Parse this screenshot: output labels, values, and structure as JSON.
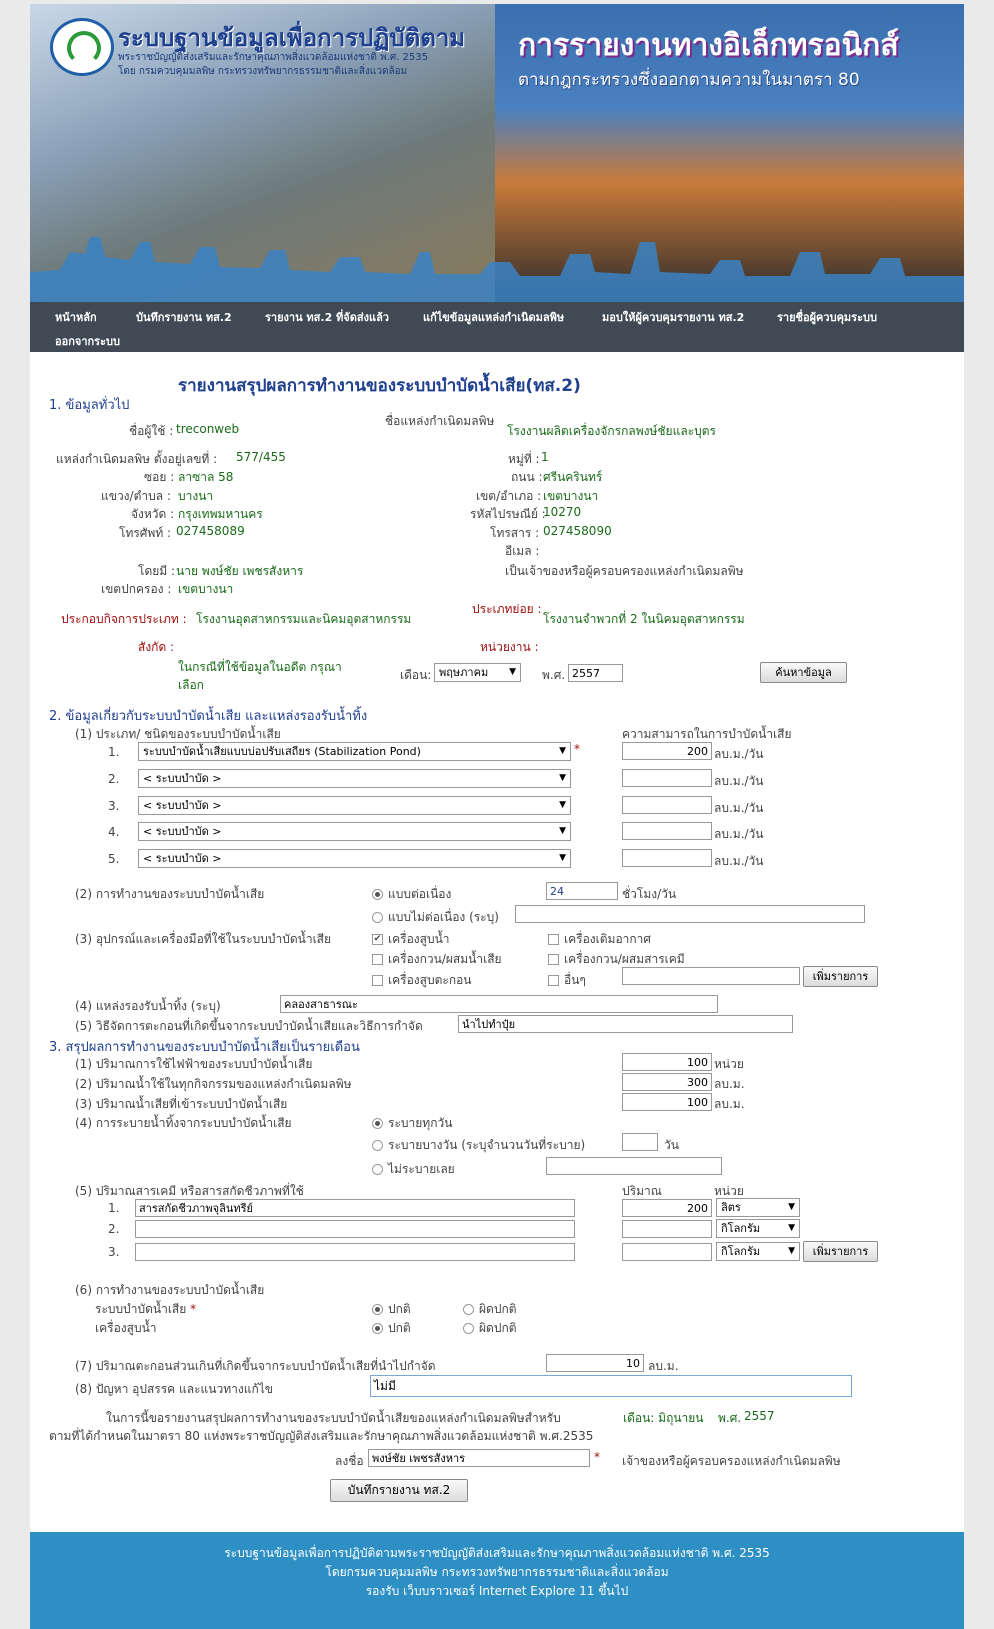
{
  "banner": {
    "left_title": "ระบบฐานข้อมูลเพื่อการปฏิบัติตาม",
    "left_sub1": "พระราชบัญญัติส่งเสริมและรักษาคุณภาพสิ่งแวดล้อมแห่งชาติ พ.ศ. 2535",
    "left_sub2": "โดย กรมควบคุมมลพิษ กระทรวงทรัพยากรธรรมชาติและสิ่งแวดล้อม",
    "right_title": "การรายงานทางอิเล็กทรอนิกส์",
    "right_sub": "ตามกฎกระทรวงซึ่งออกตามความในมาตรา 80"
  },
  "nav": {
    "home": "หน้าหลัก",
    "record": "บันทึกรายงาน ทส.2",
    "sent": "รายงาน ทส.2 ที่จัดส่งแล้ว",
    "edit_source": "แก้ไขข้อมูลแหล่งกำเนิดมลพิษ",
    "assign": "มอบให้ผู้ควบคุมรายงาน ทส.2",
    "controllers": "รายชื่อผู้ควบคุมระบบ",
    "logout": "ออกจากระบบ"
  },
  "form": {
    "title": "รายงานสรุปผลการทำงานของระบบบำบัดน้ำเสีย(ทส.2)",
    "s1": "1. ข้อมูลทั่วไป",
    "user_label": "ชื่อผู้ใช้ :",
    "user": "treconweb",
    "source_name_label": "ชื่อแหล่งกำเนิดมลพิษ",
    "source_name": "โรงงานผลิตเครื่องจักรกลพงษ์ชัยและบุตร",
    "address_label": "แหล่งกำเนิดมลพิษ ตั้งอยู่เลขที่ :",
    "address": "577/455",
    "moo_label": "หมู่ที่ :",
    "moo": "1",
    "soi_label": "ซอย :",
    "soi": "ลาซาล 58",
    "road_label": "ถนน :",
    "road": "ศรีนครินทร์",
    "subdistrict_label": "แขวง/ตำบล :",
    "subdistrict": "บางนา",
    "district_label": "เขต/อำเภอ :",
    "district": "เขตบางนา",
    "province_label": "จังหวัด :",
    "province": "กรุงเทพมหานคร",
    "postcode_label": "รหัสไปรษณีย์ :",
    "postcode": "10270",
    "phone_label": "โทรศัพท์ :",
    "phone": "027458089",
    "fax_label": "โทรสาร :",
    "fax": "027458090",
    "email_label": "อีเมล :",
    "by_label": "โดยมี :",
    "by": "นาย พงษ์ชัย เพชรสังหาร",
    "owner_role": "เป็นเจ้าของหรือผู้ครอบครองแหล่งกำเนิดมลพิษ",
    "admin_label": "เขตปกครอง :",
    "admin": "เขตบางนา",
    "biz_type_label": "ประกอบกิจการประเภท :",
    "biz_type": "โรงงานอุตสาหกรรมและนิคมอุตสาหกรรม",
    "sub_type_label": "ประเภทย่อย :",
    "sub_type": "โรงงานจำพวกที่ 2 ในนิคมอุตสาหกรรม",
    "affiliation_label": "สังกัด :",
    "unit_label": "หน่วยงาน :",
    "past_label_1": "ในกรณีที่ใช้ข้อมูลในอดีต กรุณา",
    "past_label_2": "เลือก",
    "month_label": "เดือน:",
    "month": "พฤษภาคม",
    "year_label": "พ.ศ.",
    "year": "2557",
    "search_btn": "ค้นหาข้อมูล",
    "s2": "2. ข้อมูลเกี่ยวกับระบบบำบัดน้ำเสีย และแหล่งรองรับน้ำทิ้ง",
    "q1": "(1) ประเภท/ ชนิดของระบบบำบัดน้ำเสีย",
    "capacity_label": "ความสามารถในการบำบัดน้ำเสีย",
    "systems": [
      {
        "no": "1.",
        "value": "ระบบบำบัดน้ำเสียแบบบ่อปรับเสถียร (Stabilization Pond)",
        "cap": "200",
        "unit": "ลบ.ม./วัน"
      },
      {
        "no": "2.",
        "value": "< ระบบบำบัด >",
        "cap": "",
        "unit": "ลบ.ม./วัน"
      },
      {
        "no": "3.",
        "value": "< ระบบบำบัด >",
        "cap": "",
        "unit": "ลบ.ม./วัน"
      },
      {
        "no": "4.",
        "value": "< ระบบบำบัด >",
        "cap": "",
        "unit": "ลบ.ม./วัน"
      },
      {
        "no": "5.",
        "value": "< ระบบบำบัด >",
        "cap": "",
        "unit": "ลบ.ม./วัน"
      }
    ],
    "q2": "(2) การทำงานของระบบบำบัดน้ำเสีย",
    "continuous": "แบบต่อเนื่อง",
    "hours": "24",
    "hours_unit": "ชั่วโมง/วัน",
    "non_continuous": "แบบไม่ต่อเนื่อง (ระบุ)",
    "q3": "(3) อุปกรณ์และเครื่องมือที่ใช้ในระบบบำบัดน้ำเสีย",
    "eq_pump": "เครื่องสูบน้ำ",
    "eq_aerator": "เครื่องเติมอากาศ",
    "eq_mixer": "เครื่องกวน/ผสมน้ำเสีย",
    "eq_chem_mixer": "เครื่องกวน/ผสมสารเคมี",
    "eq_sludge_pump": "เครื่องสูบตะกอน",
    "eq_other": "อื่นๆ",
    "add_btn": "เพิ่มรายการ",
    "q4": "(4) แหล่งรองรับน้ำทิ้ง (ระบุ)",
    "receiving": "คลองสาธารณะ",
    "q5": "(5) วิธีจัดการตะกอนที่เกิดขึ้นจากระบบบำบัดน้ำเสียและวิธีการกำจัด",
    "sludge_method": "นำไปทำปุ๋ย",
    "s3": "3. สรุปผลการทำงานของระบบบำบัดน้ำเสียเป็นรายเดือน",
    "m1": "(1) ปริมาณการใช้ไฟฟ้าของระบบบำบัดน้ำเสีย",
    "m1_val": "100",
    "m1_unit": "หน่วย",
    "m2": "(2) ปริมาณน้ำใช้ในทุกกิจกรรมของแหล่งกำเนิดมลพิษ",
    "m2_val": "300",
    "m2_unit": "ลบ.ม.",
    "m3": "(3) ปริมาณน้ำเสียที่เข้าระบบบำบัดน้ำเสีย",
    "m3_val": "100",
    "m3_unit": "ลบ.ม.",
    "m4": "(4) การระบายน้ำทิ้งจากระบบบำบัดน้ำเสีย",
    "m4_daily": "ระบายทุกวัน",
    "m4_some": "ระบายบางวัน (ระบุจำนวนวันที่ระบาย)",
    "m4_days_unit": "วัน",
    "m4_none": "ไม่ระบายเลย",
    "m5": "(5) ปริมาณสารเคมี หรือสารสกัดชีวภาพที่ใช้",
    "qty_label": "ปริมาณ",
    "unit_col": "หน่วย",
    "chems": [
      {
        "no": "1.",
        "name": "สารสกัดชีวภาพจุลินทรีย์",
        "qty": "200",
        "unit": "ลิตร"
      },
      {
        "no": "2.",
        "name": "",
        "qty": "",
        "unit": "กิโลกรัม"
      },
      {
        "no": "3.",
        "name": "",
        "qty": "",
        "unit": "กิโลกรัม"
      }
    ],
    "m6": "(6) การทำงานของระบบบำบัดน้ำเสีย",
    "m6_system": "ระบบบำบัดน้ำเสีย",
    "m6_pump": "เครื่องสูบน้ำ",
    "normal": "ปกติ",
    "abnormal": "ผิดปกติ",
    "m7": "(7) ปริมาณตะกอนส่วนเกินที่เกิดขึ้นจากระบบบำบัดน้ำเสียที่นำไปกำจัด",
    "m7_val": "10",
    "m7_unit": "ลบ.ม.",
    "m8": "(8) ปัญหา อุปสรรค และแนวทางแก้ไข",
    "m8_val": "ไม่มี",
    "declare1": "ในการนี้ขอรายงานสรุปผลการทำงานของระบบบำบัดน้ำเสียของแหล่งกำเนิดมลพิษสำหรับ",
    "declare_month": "เดือน: มิถุนายน",
    "declare_year_label": "พ.ศ.",
    "declare_year": "2557",
    "declare2": "ตามที่ได้กำหนดในมาตรา 80 แห่งพระราชบัญญัติส่งเสริมและรักษาคุณภาพสิ่งแวดล้อมแห่งชาติ พ.ศ.2535",
    "sign_label": "ลงชื่อ",
    "sign_name": "พงษ์ชัย เพชรสังหาร",
    "sign_role": "เจ้าของหรือผู้ครอบครองแหล่งกำเนิดมลพิษ",
    "save_btn": "บันทึกรายงาน ทส.2"
  },
  "footer": {
    "line1": "ระบบฐานข้อมูลเพื่อการปฏิบัติตามพระราชบัญญัติส่งเสริมและรักษาคุณภาพสิ่งแวดล้อมแห่งชาติ พ.ศ. 2535",
    "line2": "โดยกรมควบคุมมลพิษ กระทรวงทรัพยากรธรรมชาติและสิ่งแวดล้อม",
    "line3": "รองรับ เว็บบราวเซอร์ Internet Explore 11 ขึ้นไป"
  }
}
